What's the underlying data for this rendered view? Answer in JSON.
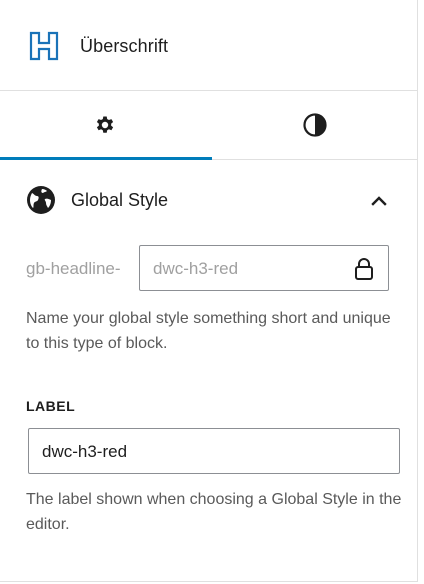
{
  "block": {
    "title": "Überschrift",
    "icon": "heading-h-icon",
    "accent": "#007cba"
  },
  "tabs": [
    {
      "label": "Settings",
      "icon": "gear-icon",
      "active": true
    },
    {
      "label": "Styles",
      "icon": "half-circle-contrast-icon",
      "active": false
    }
  ],
  "global_style": {
    "section_title": "Global Style",
    "expanded": true,
    "prefix": "gb-headline-",
    "id_value": "dwc-h3-red",
    "id_locked": true,
    "id_help": "Name your global style something short and unique to this type of block.",
    "label_title": "LABEL",
    "label_value": "dwc-h3-red",
    "label_help": "The label shown when choosing a Global Style in the editor."
  }
}
